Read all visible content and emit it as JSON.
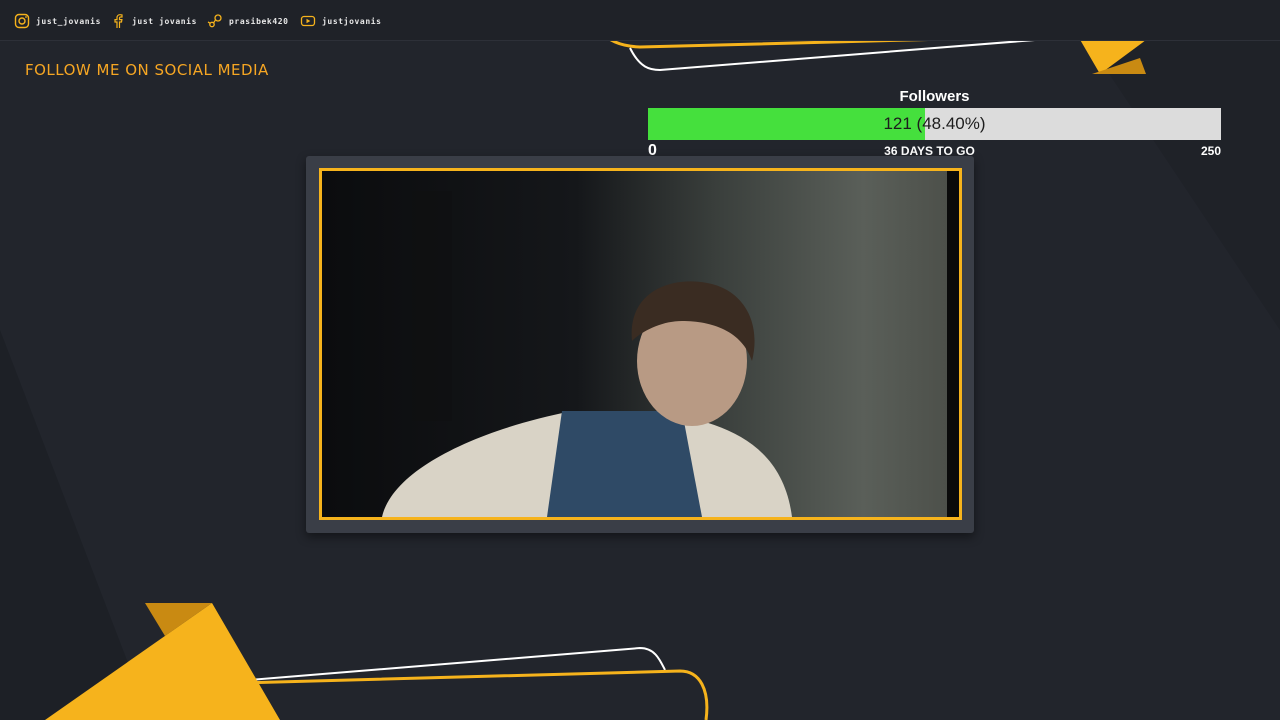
{
  "social_links": [
    {
      "icon": "instagram-icon",
      "label": "just_jovanis"
    },
    {
      "icon": "facebook-icon",
      "label": "just jovanis"
    },
    {
      "icon": "steam-icon",
      "label": "prasibek420"
    },
    {
      "icon": "youtube-icon",
      "label": "justjovanis"
    }
  ],
  "follow_heading": "FOLLOW ME ON SOCIAL MEDIA",
  "goal": {
    "title": "Followers",
    "progress_text": "121 (48.40%)",
    "progress_fraction": 0.484,
    "min_label": "0",
    "days_left": "36 DAYS TO GO",
    "max_label": "250"
  },
  "colors": {
    "accent_yellow": "#f6b31c",
    "heading_orange": "#f6a623",
    "progress_green": "#45e03d",
    "background": "#22252c"
  }
}
